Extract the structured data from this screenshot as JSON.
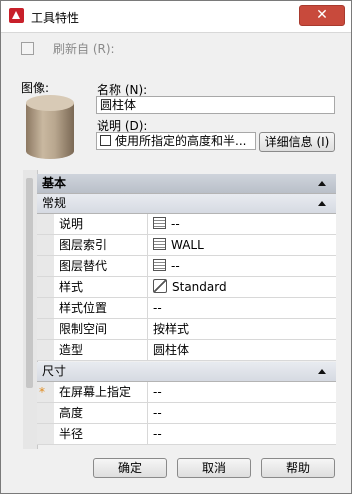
{
  "window": {
    "title": "工具特性",
    "close_glyph": "✕"
  },
  "refresh": {
    "label": "刷新自 (R):"
  },
  "image": {
    "label": "图像:"
  },
  "name": {
    "label": "名称 (N):",
    "value": "圆柱体"
  },
  "description": {
    "label": "说明 (D):",
    "value": "使用所指定的高度和半..."
  },
  "details_button": {
    "label": "详细信息 (I)"
  },
  "grid": {
    "header": "基本",
    "sections": [
      {
        "label": "常规",
        "rows": [
          {
            "name": "说明",
            "value": "--",
            "icon": "grid-icon"
          },
          {
            "name": "图层索引",
            "value": "WALL",
            "icon": "grid-icon"
          },
          {
            "name": "图层替代",
            "value": "--",
            "icon": "grid-icon"
          },
          {
            "name": "样式",
            "value": "Standard",
            "icon": "style-icon"
          },
          {
            "name": "样式位置",
            "value": "--"
          },
          {
            "name": "限制空间",
            "value": "按样式"
          },
          {
            "name": "造型",
            "value": "圆柱体"
          }
        ]
      },
      {
        "label": "尺寸",
        "rows": [
          {
            "name": "在屏幕上指定",
            "value": "--",
            "marker": "*"
          },
          {
            "name": "高度",
            "value": "--"
          },
          {
            "name": "半径",
            "value": "--"
          }
        ]
      }
    ]
  },
  "buttons": {
    "ok": "确定",
    "cancel": "取消",
    "help": "帮助"
  },
  "colors": {
    "accent_logo": "#c8202a",
    "close": "#c84a3c",
    "marker": "#e08a1c"
  }
}
